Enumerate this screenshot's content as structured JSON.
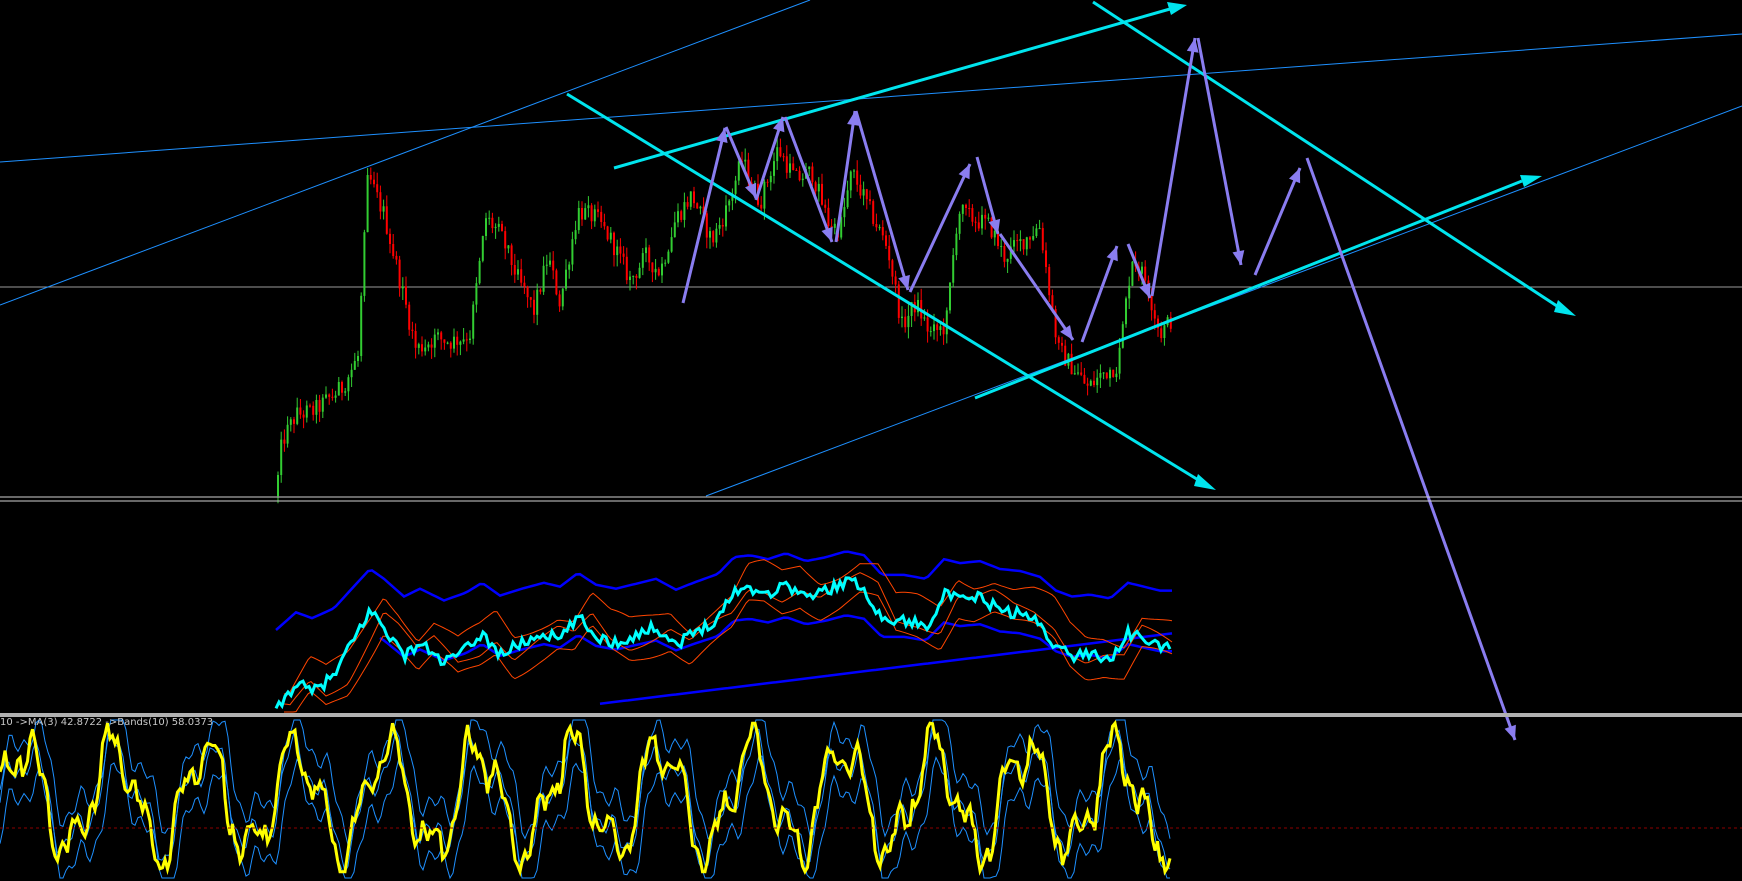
{
  "window": {
    "title": ""
  },
  "indicator_label": "10 ->MA(3) 42.8722 ->Bands(10) 58.0373",
  "colors": {
    "background": "#000000",
    "bull_candle": "#32cd32",
    "bear_candle": "#ff0000",
    "channel_lines": "#00e5ee",
    "thin_trend_lines": "#1e90ff",
    "forecast_arrows": "#8a7df0",
    "indicator_main": "#00ffff",
    "bands_outer": "#0000ff",
    "bands_inner": "#ff4500",
    "oscillator_main": "#ffff00",
    "oscillator_bands": "#1e90ff",
    "level_line": "#8b0000"
  },
  "chart_data": {
    "type": "candlestick",
    "panes": [
      "price",
      "indicator_with_bands",
      "oscillator_with_bands"
    ],
    "oscillator_label": "10 ->MA(3) 42.8722 ->Bands(10) 58.0373",
    "price_path_keypoints": [
      [
        276,
        0.0
      ],
      [
        282,
        0.14
      ],
      [
        296,
        0.21
      ],
      [
        314,
        0.22
      ],
      [
        342,
        0.28
      ],
      [
        358,
        0.36
      ],
      [
        368,
        0.83
      ],
      [
        384,
        0.73
      ],
      [
        398,
        0.58
      ],
      [
        416,
        0.38
      ],
      [
        436,
        0.41
      ],
      [
        452,
        0.4
      ],
      [
        470,
        0.42
      ],
      [
        486,
        0.72
      ],
      [
        500,
        0.68
      ],
      [
        520,
        0.55
      ],
      [
        534,
        0.48
      ],
      [
        548,
        0.62
      ],
      [
        560,
        0.5
      ],
      [
        578,
        0.74
      ],
      [
        596,
        0.72
      ],
      [
        612,
        0.66
      ],
      [
        630,
        0.56
      ],
      [
        646,
        0.62
      ],
      [
        660,
        0.58
      ],
      [
        676,
        0.72
      ],
      [
        692,
        0.78
      ],
      [
        712,
        0.66
      ],
      [
        726,
        0.74
      ],
      [
        742,
        0.87
      ],
      [
        760,
        0.76
      ],
      [
        778,
        0.9
      ],
      [
        796,
        0.82
      ],
      [
        812,
        0.84
      ],
      [
        828,
        0.71
      ],
      [
        840,
        0.69
      ],
      [
        852,
        0.84
      ],
      [
        868,
        0.75
      ],
      [
        888,
        0.64
      ],
      [
        902,
        0.44
      ],
      [
        916,
        0.5
      ],
      [
        930,
        0.42
      ],
      [
        946,
        0.44
      ],
      [
        958,
        0.74
      ],
      [
        972,
        0.72
      ],
      [
        990,
        0.7
      ],
      [
        1004,
        0.62
      ],
      [
        1022,
        0.66
      ],
      [
        1040,
        0.7
      ],
      [
        1058,
        0.38
      ],
      [
        1074,
        0.33
      ],
      [
        1088,
        0.28
      ],
      [
        1104,
        0.32
      ],
      [
        1118,
        0.34
      ],
      [
        1132,
        0.62
      ],
      [
        1146,
        0.56
      ],
      [
        1160,
        0.42
      ],
      [
        1172,
        0.46
      ]
    ],
    "indicator_path_keypoints": [
      [
        276,
        0.0
      ],
      [
        296,
        0.18
      ],
      [
        312,
        0.12
      ],
      [
        334,
        0.22
      ],
      [
        350,
        0.4
      ],
      [
        370,
        0.62
      ],
      [
        384,
        0.52
      ],
      [
        404,
        0.34
      ],
      [
        420,
        0.42
      ],
      [
        444,
        0.3
      ],
      [
        466,
        0.38
      ],
      [
        482,
        0.48
      ],
      [
        500,
        0.35
      ],
      [
        522,
        0.42
      ],
      [
        544,
        0.48
      ],
      [
        560,
        0.44
      ],
      [
        578,
        0.58
      ],
      [
        596,
        0.46
      ],
      [
        616,
        0.42
      ],
      [
        636,
        0.47
      ],
      [
        656,
        0.52
      ],
      [
        676,
        0.41
      ],
      [
        696,
        0.49
      ],
      [
        718,
        0.57
      ],
      [
        734,
        0.74
      ],
      [
        750,
        0.76
      ],
      [
        768,
        0.72
      ],
      [
        786,
        0.78
      ],
      [
        806,
        0.7
      ],
      [
        826,
        0.74
      ],
      [
        846,
        0.8
      ],
      [
        864,
        0.76
      ],
      [
        882,
        0.56
      ],
      [
        904,
        0.56
      ],
      [
        926,
        0.52
      ],
      [
        944,
        0.72
      ],
      [
        960,
        0.68
      ],
      [
        980,
        0.7
      ],
      [
        1000,
        0.62
      ],
      [
        1020,
        0.6
      ],
      [
        1040,
        0.54
      ],
      [
        1056,
        0.4
      ],
      [
        1072,
        0.34
      ],
      [
        1090,
        0.36
      ],
      [
        1110,
        0.32
      ],
      [
        1128,
        0.48
      ],
      [
        1144,
        0.44
      ],
      [
        1160,
        0.4
      ],
      [
        1172,
        0.4
      ]
    ],
    "oscillator_levels": {
      "signal_level": 0.3
    }
  }
}
